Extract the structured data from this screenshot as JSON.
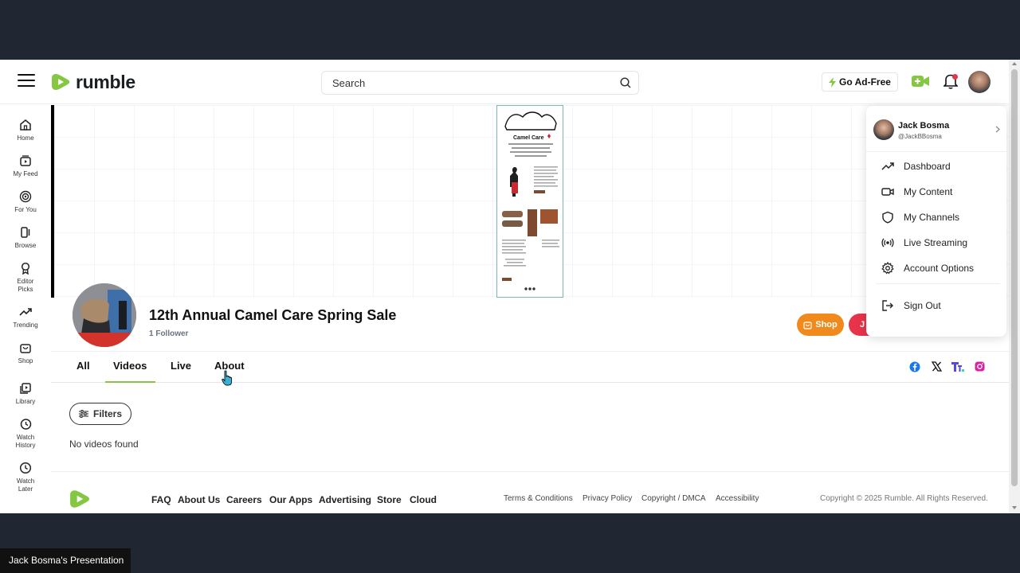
{
  "header": {
    "logo_text": "rumble",
    "search_placeholder": "Search",
    "ad_free_label": "Go Ad-Free",
    "brand_green": "#85c742"
  },
  "sidebar": {
    "items": [
      {
        "label": "Home",
        "icon": "home-icon"
      },
      {
        "label": "My Feed",
        "icon": "feed-icon"
      },
      {
        "label": "For You",
        "icon": "target-icon"
      },
      {
        "label": "Browse",
        "icon": "browse-icon"
      },
      {
        "label": "Editor Picks",
        "icon": "award-icon"
      },
      {
        "label": "Trending",
        "icon": "trending-icon"
      },
      {
        "label": "Shop",
        "icon": "shop-icon"
      },
      {
        "label": "Library",
        "icon": "library-icon"
      },
      {
        "label": "Watch History",
        "icon": "history-icon"
      },
      {
        "label": "Watch Later",
        "icon": "clock-icon"
      }
    ]
  },
  "banner": {
    "flyer_brand": "Camel Care"
  },
  "channel": {
    "title": "12th Annual Camel Care Spring Sale",
    "followers": "1 Follower",
    "shop_label": "Shop",
    "join_label": "J"
  },
  "tabs": [
    "All",
    "Videos",
    "Live",
    "About"
  ],
  "content": {
    "filters_label": "Filters",
    "empty_text": "No videos found"
  },
  "footer": {
    "links": [
      "FAQ",
      "About Us",
      "Careers",
      "Our Apps",
      "Advertising",
      "Store",
      "Cloud"
    ],
    "legal_links": [
      "Terms & Conditions",
      "Privacy Policy",
      "Copyright / DMCA",
      "Accessibility"
    ],
    "copyright": "Copyright © 2025 Rumble. All Rights Reserved."
  },
  "dropdown": {
    "user_name": "Jack Bosma",
    "user_handle": "@JackBBosma",
    "items": [
      "Dashboard",
      "My Content",
      "My Channels",
      "Live Streaming",
      "Account Options"
    ],
    "sign_out": "Sign Out"
  },
  "overlay": {
    "presenter_label": "Jack Bosma's Presentation"
  }
}
